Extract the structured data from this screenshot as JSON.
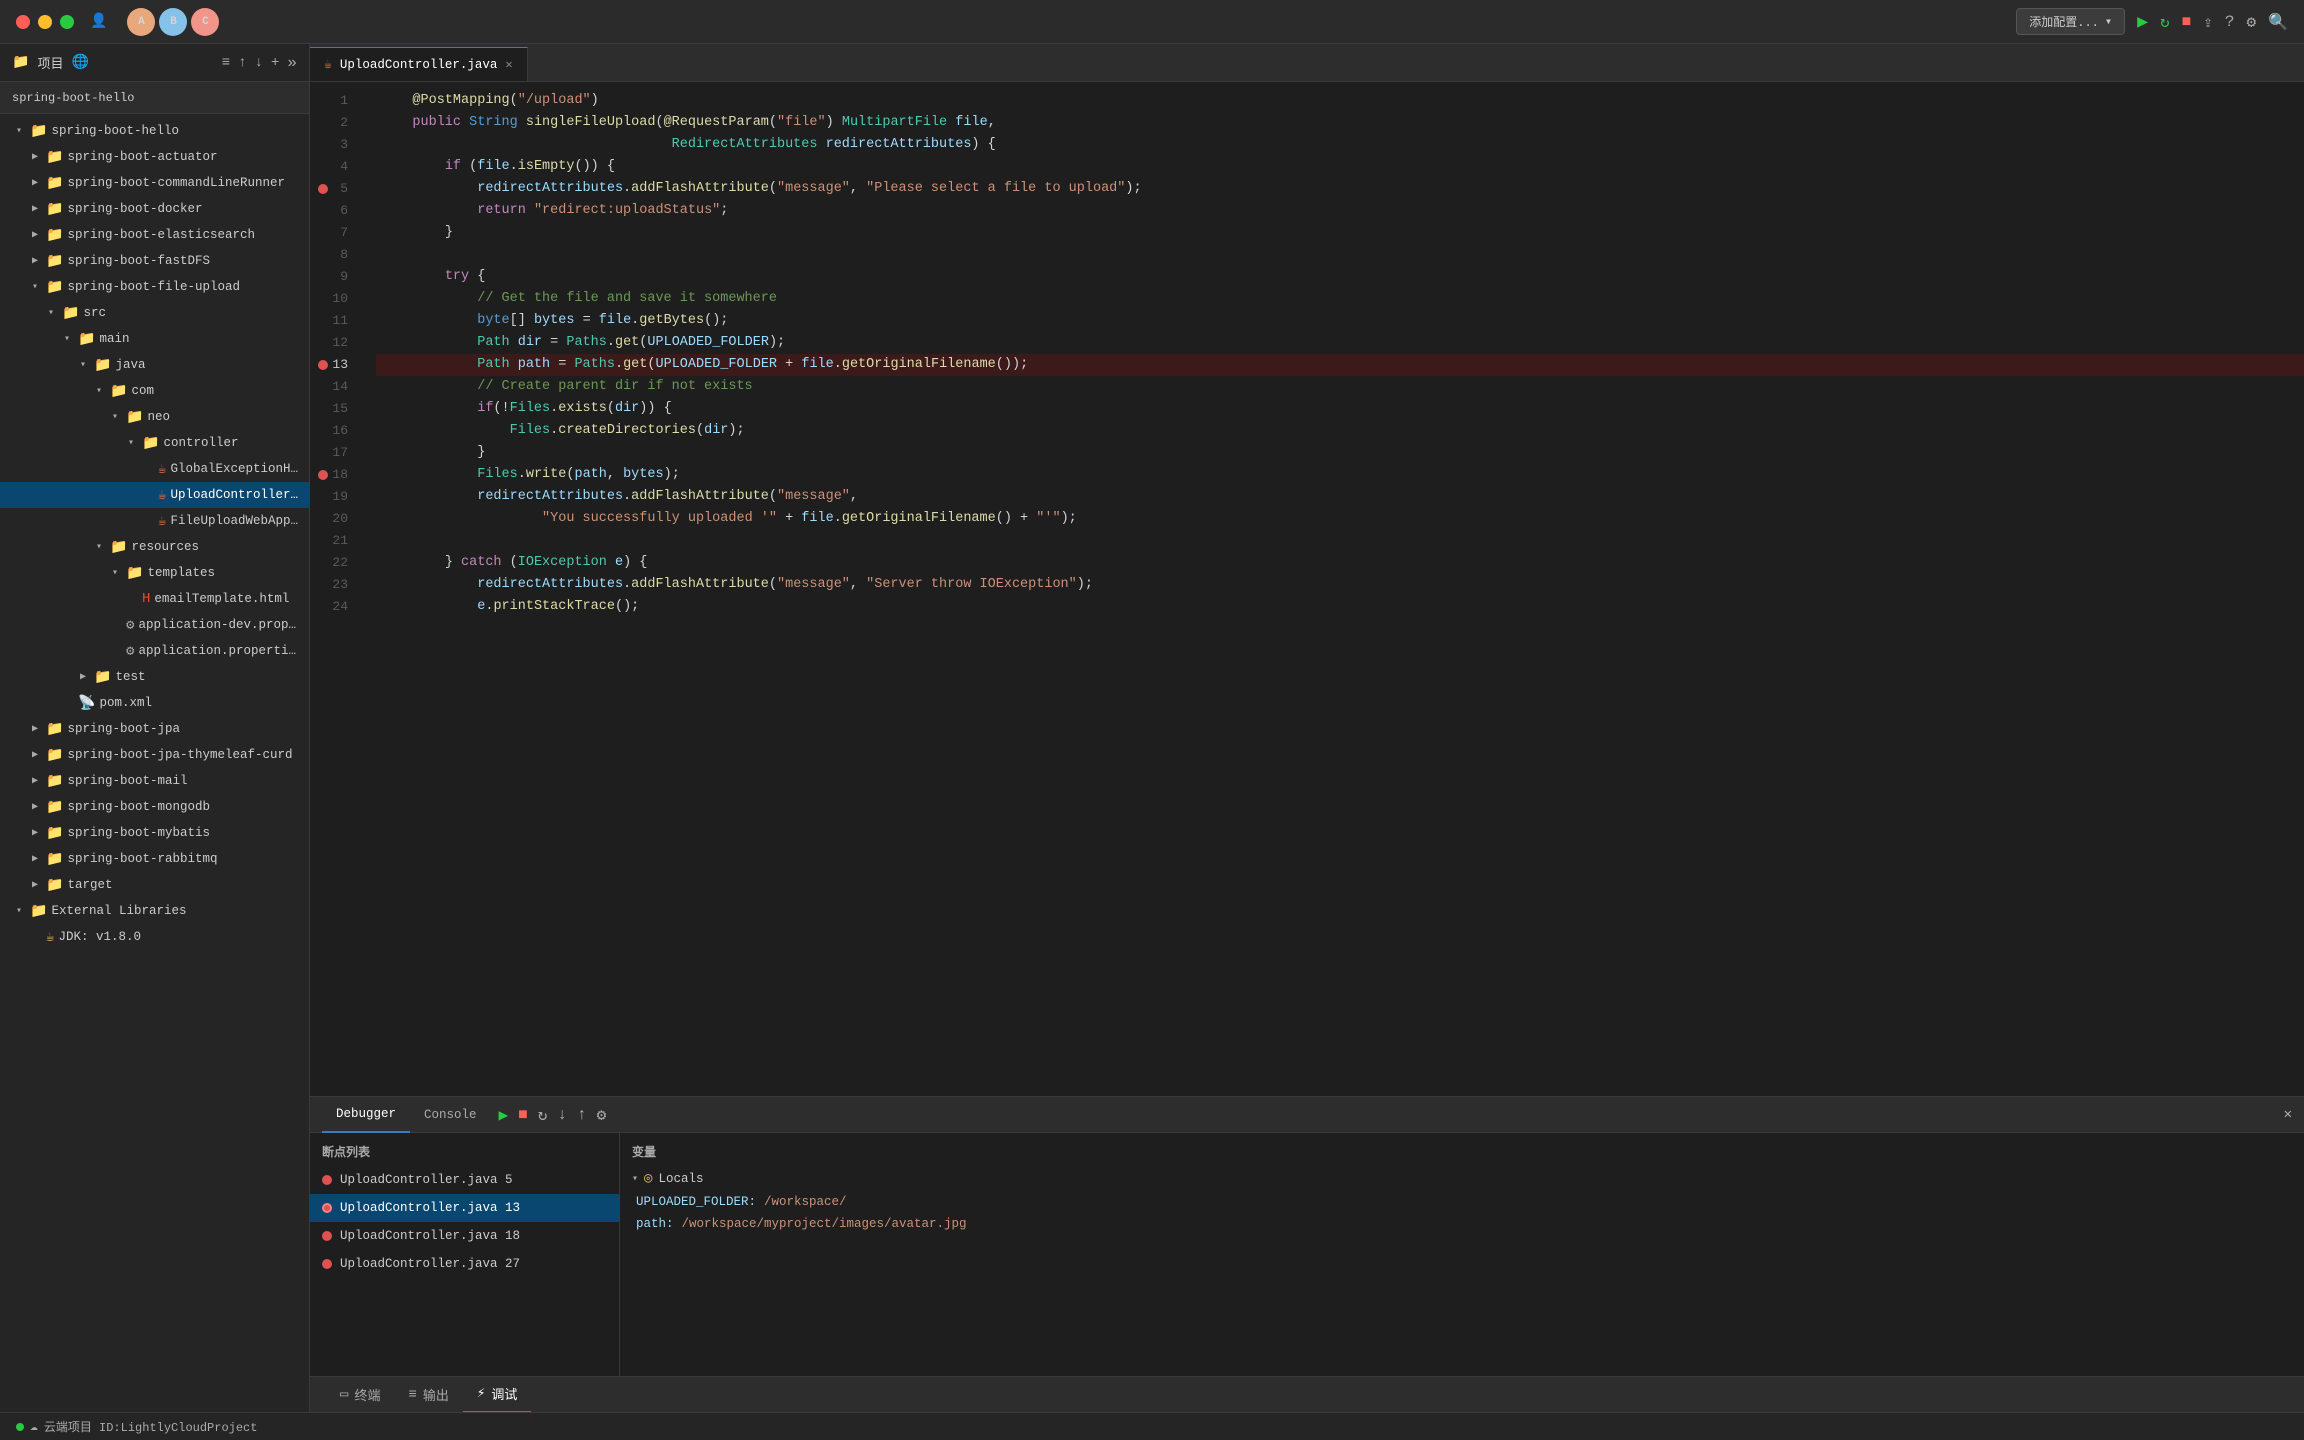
{
  "titlebar": {
    "add_config_label": "添加配置...",
    "project_icon": "📁",
    "web_icon": "🌐"
  },
  "sidebar": {
    "title": "项目",
    "root_name": "spring-boot-hello",
    "tree_items": [
      {
        "id": "spring-boot-hello",
        "label": "spring-boot-hello",
        "indent": 1,
        "type": "folder",
        "expanded": true
      },
      {
        "id": "spring-boot-actuator",
        "label": "spring-boot-actuator",
        "indent": 2,
        "type": "folder",
        "expanded": false
      },
      {
        "id": "spring-boot-commandLineRunner",
        "label": "spring-boot-commandLineRunner",
        "indent": 2,
        "type": "folder",
        "expanded": false
      },
      {
        "id": "spring-boot-docker",
        "label": "spring-boot-docker",
        "indent": 2,
        "type": "folder",
        "expanded": false
      },
      {
        "id": "spring-boot-elasticsearch",
        "label": "spring-boot-elasticsearch",
        "indent": 2,
        "type": "folder",
        "expanded": false
      },
      {
        "id": "spring-boot-fastDFS",
        "label": "spring-boot-fastDFS",
        "indent": 2,
        "type": "folder",
        "expanded": false
      },
      {
        "id": "spring-boot-file-upload",
        "label": "spring-boot-file-upload",
        "indent": 2,
        "type": "folder",
        "expanded": true
      },
      {
        "id": "src",
        "label": "src",
        "indent": 3,
        "type": "folder",
        "expanded": true
      },
      {
        "id": "main",
        "label": "main",
        "indent": 4,
        "type": "folder",
        "expanded": true
      },
      {
        "id": "java",
        "label": "java",
        "indent": 5,
        "type": "folder",
        "expanded": true
      },
      {
        "id": "com",
        "label": "com",
        "indent": 6,
        "type": "folder",
        "expanded": true
      },
      {
        "id": "neo",
        "label": "neo",
        "indent": 7,
        "type": "folder",
        "expanded": true
      },
      {
        "id": "controller",
        "label": "controller",
        "indent": 8,
        "type": "folder",
        "expanded": true
      },
      {
        "id": "GlobalExceptionHandler",
        "label": "GlobalExceptionHandler.ja...",
        "indent": 9,
        "type": "java"
      },
      {
        "id": "UploadController",
        "label": "UploadController.java",
        "indent": 9,
        "type": "java",
        "selected": true
      },
      {
        "id": "FileUploadWebApplication",
        "label": "FileUploadWebApplication.ja...",
        "indent": 9,
        "type": "java"
      },
      {
        "id": "resources",
        "label": "resources",
        "indent": 6,
        "type": "folder",
        "expanded": true
      },
      {
        "id": "templates",
        "label": "templates",
        "indent": 7,
        "type": "folder",
        "expanded": true
      },
      {
        "id": "emailTemplate",
        "label": "emailTemplate.html",
        "indent": 8,
        "type": "html"
      },
      {
        "id": "application-dev",
        "label": "application-dev.properties",
        "indent": 7,
        "type": "props"
      },
      {
        "id": "application",
        "label": "application.properties",
        "indent": 7,
        "type": "props"
      },
      {
        "id": "test",
        "label": "test",
        "indent": 5,
        "type": "folder",
        "expanded": false
      },
      {
        "id": "pom",
        "label": "pom.xml",
        "indent": 4,
        "type": "xml"
      },
      {
        "id": "spring-boot-jpa",
        "label": "spring-boot-jpa",
        "indent": 2,
        "type": "folder",
        "expanded": false
      },
      {
        "id": "spring-boot-jpa-thymeleaf-curd",
        "label": "spring-boot-jpa-thymeleaf-curd",
        "indent": 2,
        "type": "folder",
        "expanded": false
      },
      {
        "id": "spring-boot-mail",
        "label": "spring-boot-mail",
        "indent": 2,
        "type": "folder",
        "expanded": false
      },
      {
        "id": "spring-boot-mongodb",
        "label": "spring-boot-mongodb",
        "indent": 2,
        "type": "folder",
        "expanded": false
      },
      {
        "id": "spring-boot-mybatis",
        "label": "spring-boot-mybatis",
        "indent": 2,
        "type": "folder",
        "expanded": false
      },
      {
        "id": "spring-boot-rabbitmq",
        "label": "spring-boot-rabbitmq",
        "indent": 2,
        "type": "folder",
        "expanded": false
      },
      {
        "id": "target",
        "label": "target",
        "indent": 2,
        "type": "folder",
        "expanded": false
      },
      {
        "id": "External Libraries",
        "label": "External Libraries",
        "indent": 1,
        "type": "folder-special",
        "expanded": true
      },
      {
        "id": "JDK",
        "label": "JDK: v1.8.0",
        "indent": 2,
        "type": "jdk"
      }
    ]
  },
  "editor": {
    "tab_label": "UploadController.java",
    "tab_icon": "☕",
    "lines": [
      {
        "num": 1,
        "content": "    @PostMapping(\"/upload\")"
      },
      {
        "num": 2,
        "content": "    public String singleFileUpload(@RequestParam(\"file\") MultipartFile file,"
      },
      {
        "num": 3,
        "content": "                                   RedirectAttributes redirectAttributes) {"
      },
      {
        "num": 4,
        "content": "        if (file.isEmpty()) {"
      },
      {
        "num": 5,
        "content": "            redirectAttributes.addFlashAttribute(\"message\", \"Please select a file to upload\");",
        "breakpoint": true
      },
      {
        "num": 6,
        "content": "            return \"redirect:uploadStatus\";"
      },
      {
        "num": 7,
        "content": "        }"
      },
      {
        "num": 8,
        "content": ""
      },
      {
        "num": 9,
        "content": "        try {"
      },
      {
        "num": 10,
        "content": "            // Get the file and save it somewhere"
      },
      {
        "num": 11,
        "content": "            byte[] bytes = file.getBytes();"
      },
      {
        "num": 12,
        "content": "            Path dir = Paths.get(UPLOADED_FOLDER);"
      },
      {
        "num": 13,
        "content": "            Path path = Paths.get(UPLOADED_FOLDER + file.getOriginalFilename());",
        "breakpoint": true,
        "highlighted": true
      },
      {
        "num": 14,
        "content": "            // Create parent dir if not exists"
      },
      {
        "num": 15,
        "content": "            if(!Files.exists(dir)) {"
      },
      {
        "num": 16,
        "content": "                Files.createDirectories(dir);"
      },
      {
        "num": 17,
        "content": "            }"
      },
      {
        "num": 18,
        "content": "            Files.write(path, bytes);",
        "breakpoint": true
      },
      {
        "num": 19,
        "content": "            redirectAttributes.addFlashAttribute(\"message\","
      },
      {
        "num": 20,
        "content": "                    \"You successfully uploaded '\" + file.getOriginalFilename() + \"'\");"
      },
      {
        "num": 21,
        "content": ""
      },
      {
        "num": 22,
        "content": "        } catch (IOException e) {"
      },
      {
        "num": 23,
        "content": "            redirectAttributes.addFlashAttribute(\"message\", \"Server throw IOException\");"
      },
      {
        "num": 24,
        "content": "            e.printStackTrace();"
      }
    ]
  },
  "debug": {
    "debugger_tab": "Debugger",
    "console_tab": "Console",
    "breakpoints_title": "断点列表",
    "variables_title": "变量",
    "breakpoints": [
      {
        "label": "UploadController.java 5",
        "active": false
      },
      {
        "label": "UploadController.java 13",
        "active": true,
        "selected": true
      },
      {
        "label": "UploadController.java 18",
        "active": false
      },
      {
        "label": "UploadController.java 27",
        "active": false
      }
    ],
    "variables": [
      {
        "type": "group",
        "label": "Locals"
      },
      {
        "key": "UPLOADED_FOLDER:",
        "value": "/workspace/"
      },
      {
        "key": "path:",
        "value": "/workspace/myproject/images/avatar.jpg"
      }
    ]
  },
  "bottom_bar": {
    "terminal_label": "终端",
    "output_label": "输出",
    "debug_label": "调试"
  },
  "status_bar": {
    "cloud_label": "云端项目 ID:LightlyCloudProject"
  }
}
